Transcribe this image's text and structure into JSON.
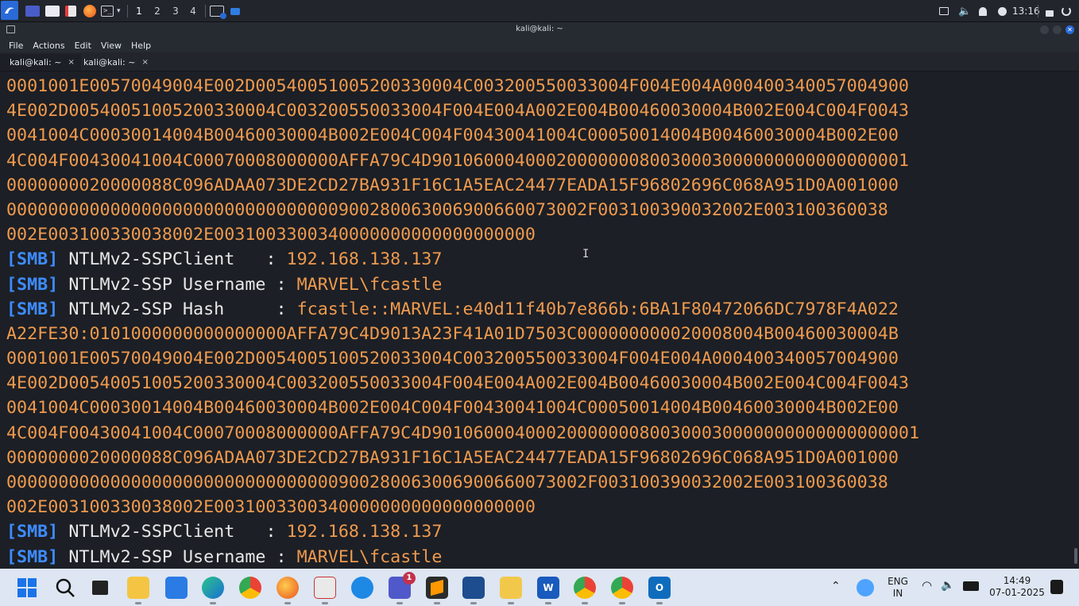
{
  "topbar": {
    "workspaces": [
      "1",
      "2",
      "3",
      "4"
    ],
    "clock": "13:16",
    "icons": [
      "kali-menu-icon",
      "desktop-icon",
      "files-icon",
      "text-editor-icon",
      "firefox-icon",
      "terminal-icon",
      "show-desktop-icon",
      "monitor-icon",
      "volume-icon",
      "notifications-icon",
      "clock-icon",
      "lock-icon",
      "power-icon"
    ]
  },
  "window": {
    "title": "kali@kali: ~"
  },
  "menu": [
    "File",
    "Actions",
    "Edit",
    "View",
    "Help"
  ],
  "tabs": [
    {
      "label": "kali@kali: ~",
      "close": "×"
    },
    {
      "label": "kali@kali: ~",
      "close": "×"
    }
  ],
  "terminal": {
    "lines": [
      {
        "type": "hex",
        "text": "0001001E00570049004E002D00540051005200330004C00320055003300 4F004E004A00040034005700490 0"
      },
      {
        "type": "hex",
        "text": "4E002D005400510052003 30004C003200550033004F004E004A002E004B00460030004B002E004C004F0043"
      },
      {
        "type": "hex",
        "text": "0041004C00030014004B00460030004B002E004C004F00430041004C000500140 04B00460030004B002E00"
      },
      {
        "type": "hex",
        "text": "4C004F00430041004C0007000800000 0AFFA79C4D9010600040002000000080030003000000000000000001"
      },
      {
        "type": "hex",
        "text": "0000000020000088C096ADAA073DE2CD27BA931F16C1A5EAC24477EADA15F96802696C068A951D0A001000"
      },
      {
        "type": "hex",
        "text": "00000000000000000000000000000000900280063006900660073002F003100390032002E003100360038"
      },
      {
        "type": "hex",
        "text": "002E003100330038002E0031003300340000000000000000000"
      },
      {
        "type": "kv",
        "tag": "[SMB]",
        "label": "NTLMv2-SSP Client   : ",
        "value": "192.168.138.137"
      },
      {
        "type": "kv",
        "tag": "[SMB]",
        "label": "NTLMv2-SSP Username : ",
        "value": "MARVEL\\fcastle"
      },
      {
        "type": "kv",
        "tag": "[SMB]",
        "label": "NTLMv2-SSP Hash     : ",
        "value": "fcastle::MARVEL:e40d11f40b7e866b:6BA1F80472066DC7978F4A022"
      },
      {
        "type": "hex",
        "text": "A22FE30:0101000000000000000AFFA79C4D9013A23F41A01D7503C000000000020008004B00460030004B"
      },
      {
        "type": "hex",
        "text": "0001001E00570049004E002D005400510052003300 4C003200550033004F004E004A00040034005700490 0"
      },
      {
        "type": "hex",
        "text": "4E002D00540051005200330004C003200550033004F004E004A002E004B00460030004B002E004C004F0043"
      },
      {
        "type": "hex",
        "text": "0041004C00030014004B00460030004B002E004C004F00430041004C00050014004B00460030004B002E00"
      },
      {
        "type": "hex",
        "text": "4C004F00430041004C00070008000000AFFA79C4D90106000400020000000800300030000000000000000001"
      },
      {
        "type": "hex",
        "text": "0000000020000088C096ADAA073DE2CD27BA931F16C1A5EAC24477EADA15F96802696C068A951D0A001000"
      },
      {
        "type": "hex",
        "text": "00000000000000000000000000000000900280063006900660073002F003100390032002E003100360038"
      },
      {
        "type": "hex",
        "text": "002E003100330038002E0031003300340000000000000000000"
      },
      {
        "type": "kv",
        "tag": "[SMB]",
        "label": "NTLMv2-SSP Client   : ",
        "value": "192.168.138.137"
      },
      {
        "type": "kv",
        "tag": "[SMB]",
        "label": "NTLMv2-SSP Username : ",
        "value": "MARVEL\\fcastle"
      }
    ]
  },
  "taskbar": {
    "apps": [
      "start-icon",
      "search-icon",
      "task-view-icon",
      "file-explorer-icon",
      "calendar-icon",
      "edge-icon",
      "chrome-icon",
      "firefox-icon",
      "snipping-tool-icon",
      "app-icon",
      "teams-icon",
      "sublime-icon",
      "virtualbox-icon",
      "notepad-plus-icon",
      "word-icon",
      "chrome-profile-icon",
      "chrome-icon-2",
      "outlook-icon"
    ],
    "teams_badge": "1",
    "lang_line1": "ENG",
    "lang_line2": "IN",
    "time": "14:49",
    "date": "07-01-2025"
  }
}
